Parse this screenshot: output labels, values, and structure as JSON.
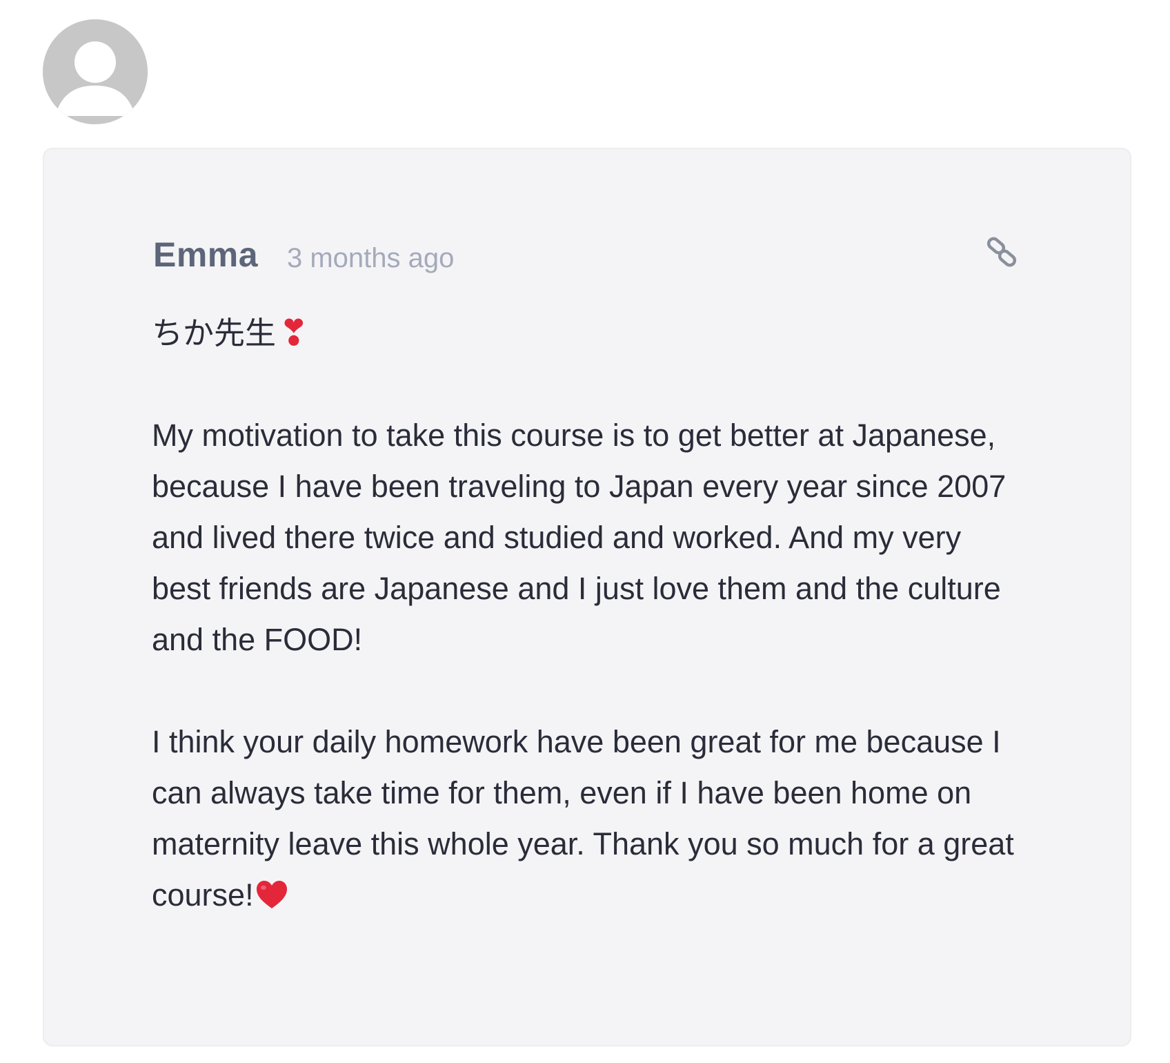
{
  "comment": {
    "author": "Emma",
    "timestamp": "3 months ago",
    "greeting": "ちか先生",
    "greeting_emoji": "❣",
    "paragraphs": [
      "My motivation to take this course is to get better at Japanese, because I have been traveling to Japan every year since 2007 and lived there twice and studied and worked. And my very best friends are Japanese and I just love them and the culture and the FOOD!",
      "I think your daily homework have been great for me because I can always take time for them, even if I have been home on maternity leave this whole year. Thank you so much for a great course!"
    ],
    "closing_emoji": "heart-emoji",
    "avatar_icon": "default-user-avatar-icon",
    "permalink_icon": "link-icon"
  },
  "colors": {
    "card_background": "#f4f4f6",
    "author": "#5d6579",
    "timestamp": "#a4aabb",
    "body_text": "#2a2c39",
    "avatar_background": "#c7c7c7",
    "heart": "#e4263b"
  }
}
